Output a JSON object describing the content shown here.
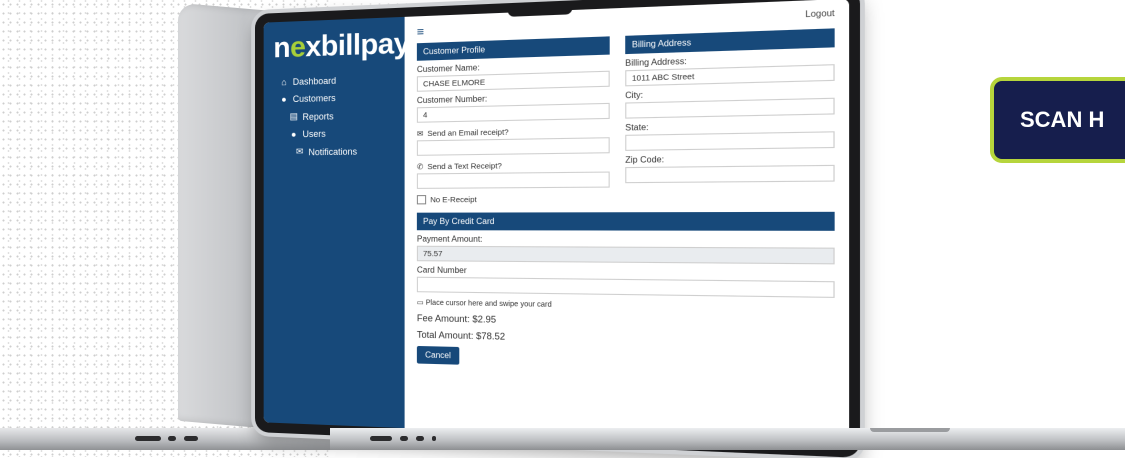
{
  "brand": {
    "logo_prefix": "n",
    "logo_accent": "e",
    "logo_suffix": "xbillpay",
    "accent_color": "#a6ce39",
    "primary_color": "#17497a"
  },
  "sidebar": {
    "items": [
      {
        "label": "Dashboard",
        "icon": "home-icon"
      },
      {
        "label": "Customers",
        "icon": "user-icon"
      },
      {
        "label": "Reports",
        "icon": "report-icon"
      },
      {
        "label": "Users",
        "icon": "user-icon"
      },
      {
        "label": "Notifications",
        "icon": "envelope-icon"
      }
    ]
  },
  "topbar": {
    "logout": "Logout"
  },
  "customer_profile": {
    "title": "Customer Profile",
    "name_label": "Customer Name:",
    "name_value": "CHASE ELMORE",
    "number_label": "Customer Number:",
    "number_value": "4",
    "email_receipt": "Send an Email receipt?",
    "text_receipt": "Send a Text Receipt?",
    "no_receipt": "No E-Receipt"
  },
  "billing": {
    "title": "Billing Address",
    "address_label": "Billing Address:",
    "address_value": "1011 ABC Street",
    "city_label": "City:",
    "state_label": "State:",
    "zip_label": "Zip Code:"
  },
  "payment": {
    "title": "Pay By Credit Card",
    "amount_label": "Payment Amount:",
    "amount_value": "75.57",
    "card_label": "Card Number",
    "swipe_hint": "Place cursor here and swipe your card",
    "fee": "Fee Amount: $2.95",
    "total": "Total Amount: $78.52",
    "cancel": "Cancel"
  },
  "cta": {
    "label": "SCAN H"
  }
}
